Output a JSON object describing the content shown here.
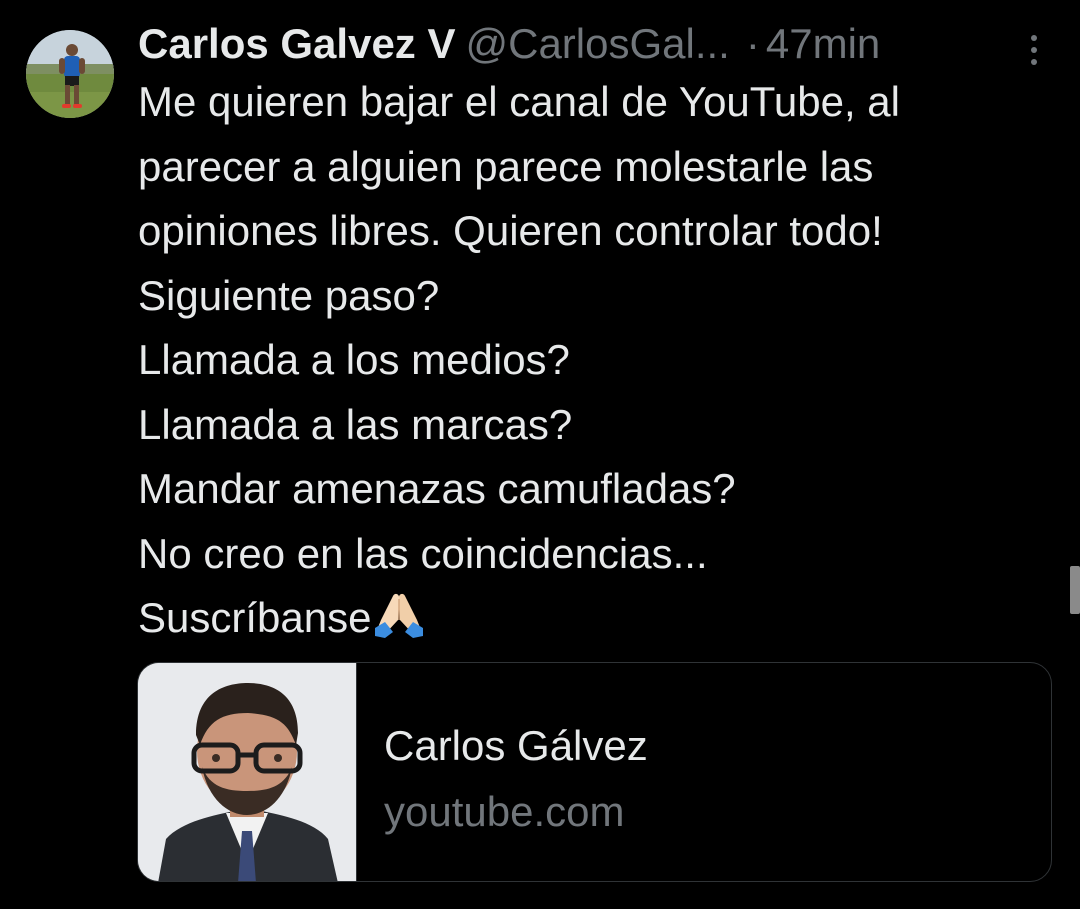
{
  "tweet": {
    "author": {
      "display_name": "Carlos Galvez V",
      "handle": "@CarlosGal...",
      "avatar_icon": "user-avatar-photo"
    },
    "separator": "·",
    "timestamp": "47min",
    "more_icon": "vertical-ellipsis-icon",
    "text_lines": [
      "Me quieren bajar el canal de YouTube, al",
      "parecer a alguien parece molestarle las",
      "opiniones libres. Quieren controlar todo!",
      "Siguiente paso?",
      "Llamada a los medios?",
      "Llamada a las marcas?",
      "Mandar amenazas camufladas?",
      "No creo en las coincidencias...",
      "Suscríbanse"
    ],
    "trailing_emoji": "🙏",
    "link_card": {
      "title": "Carlos Gálvez",
      "domain": "youtube.com",
      "thumbnail_icon": "person-portrait-photo"
    }
  },
  "colors": {
    "background": "#000000",
    "primary_text": "#e7e9ea",
    "secondary_text": "#71767b",
    "card_border": "#2f3336"
  }
}
